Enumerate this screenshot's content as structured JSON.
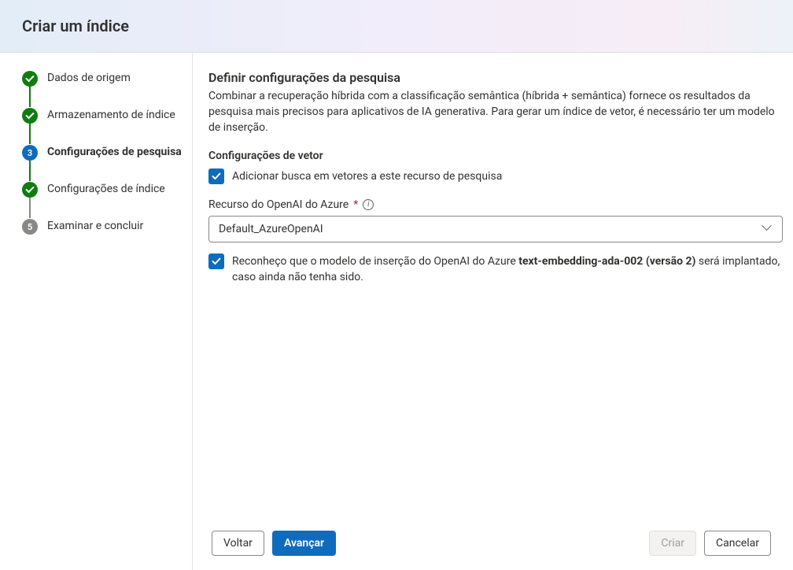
{
  "header": {
    "title": "Criar um índice"
  },
  "steps": [
    {
      "label": "Dados de origem",
      "state": "done"
    },
    {
      "label": "Armazenamento de índice",
      "state": "done"
    },
    {
      "label": "Configurações de pesquisa",
      "state": "current",
      "number": "3"
    },
    {
      "label": "Configurações de índice",
      "state": "done"
    },
    {
      "label": "Examinar e concluir",
      "state": "pending",
      "number": "5"
    }
  ],
  "main": {
    "section_title": "Definir configurações da pesquisa",
    "section_desc": "Combinar a recuperação híbrida com a classificação semântica (híbrida + semântica) fornece os resultados da pesquisa mais precisos para aplicativos de IA generativa. Para gerar um índice de vetor, é necessário ter um modelo de inserção.",
    "vector_heading": "Configurações de vetor",
    "vector_checkbox_label": "Adicionar busca em vetores a este recurso de pesquisa",
    "vector_checkbox_checked": true,
    "resource_label": "Recurso do OpenAI do Azure",
    "resource_required_marker": "*",
    "resource_selected": "Default_AzureOpenAI",
    "ack_checked": true,
    "ack_prefix": "Reconheço que o modelo de inserção do OpenAI do Azure ",
    "ack_bold": "text-embedding-ada-002 (versão 2)",
    "ack_suffix": " será implantado, caso ainda não tenha sido."
  },
  "footer": {
    "back": "Voltar",
    "next": "Avançar",
    "create": "Criar",
    "cancel": "Cancelar"
  }
}
